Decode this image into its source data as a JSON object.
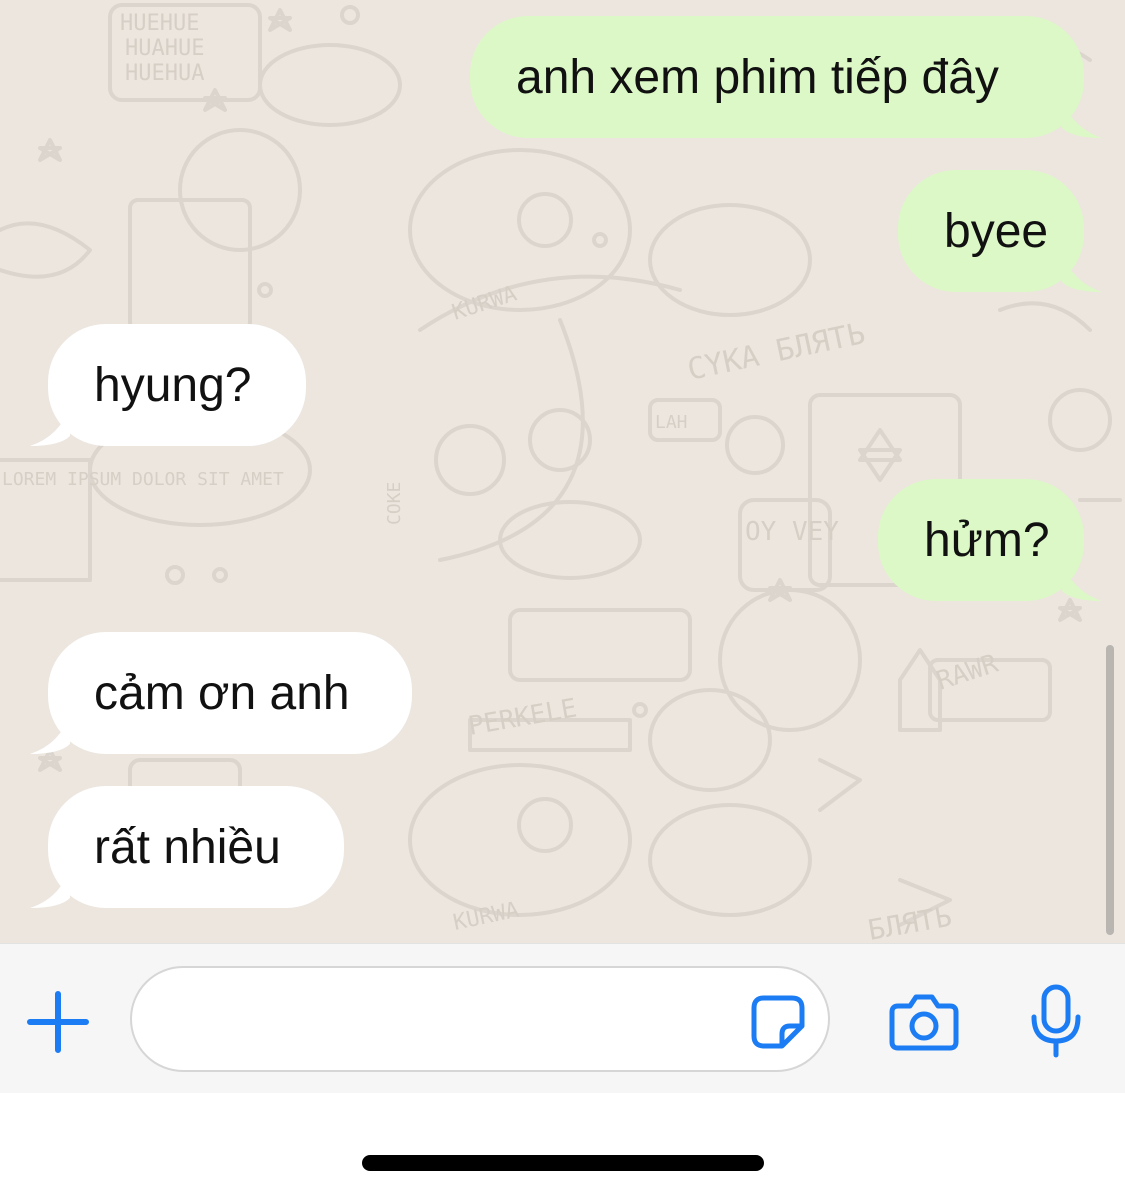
{
  "conversation": {
    "messages": [
      {
        "direction": "outgoing",
        "text": "anh xem phim tiếp đây"
      },
      {
        "direction": "outgoing",
        "text": "byee"
      },
      {
        "direction": "incoming",
        "text": "hyung?"
      },
      {
        "direction": "outgoing",
        "text": "hửm?"
      },
      {
        "direction": "incoming",
        "text": "cảm ơn anh"
      },
      {
        "direction": "incoming",
        "text": "rất nhiều"
      }
    ],
    "wallpaper_doodle_text": [
      "HUEHUE",
      "HUAHUE",
      "HUEHUA",
      "KURWA",
      "CYKA БЛЯТЬ",
      "LAH",
      "OY VEY",
      "LOREM IPSUM DOLOR SIT AMET",
      "PERKELE",
      "RAWR",
      "COKE",
      "KURWA",
      "БЛЯТЬ"
    ]
  },
  "composer": {
    "input_value": "",
    "icons": {
      "attach": "plus-icon",
      "sticker": "sticker-icon",
      "camera": "camera-icon",
      "microphone": "microphone-icon"
    }
  },
  "colors": {
    "outgoing_bubble": "#dcf8c6",
    "incoming_bubble": "#ffffff",
    "wallpaper": "#ece6df",
    "accent": "#1c7cf4"
  }
}
